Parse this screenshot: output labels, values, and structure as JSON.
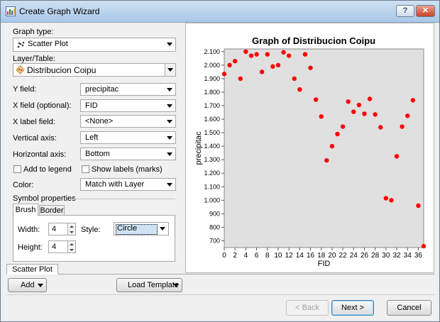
{
  "window": {
    "title": "Create Graph Wizard",
    "help_label": "?",
    "close_label": "✕"
  },
  "form": {
    "graph_type_label": "Graph type:",
    "graph_type_value": "Scatter Plot",
    "layer_label": "Layer/Table:",
    "layer_value": "Distribucion Coipu",
    "y_field_label": "Y field:",
    "y_field_value": "precipitac",
    "x_field_label": "X field (optional):",
    "x_field_value": "FID",
    "x_label_field_label": "X label field:",
    "x_label_field_value": "<None>",
    "vertical_axis_label": "Vertical axis:",
    "vertical_axis_value": "Left",
    "horizontal_axis_label": "Horizontal axis:",
    "horizontal_axis_value": "Bottom",
    "add_to_legend_label": "Add to legend",
    "add_to_legend_checked": false,
    "show_labels_label": "Show labels (marks)",
    "show_labels_checked": false,
    "color_label": "Color:",
    "color_value": "Match with Layer",
    "symbol_properties_label": "Symbol properties",
    "tabs": [
      {
        "label": "Brush"
      },
      {
        "label": "Border"
      }
    ],
    "width_label": "Width:",
    "width_value": "4",
    "style_label": "Style:",
    "style_value": "Circle",
    "height_label": "Height:",
    "height_value": "4"
  },
  "bottom": {
    "graph_tab_label": "Scatter Plot",
    "add_label": "Add",
    "load_template_label": "Load Template"
  },
  "footer": {
    "back_label": "< Back",
    "next_label": "Next >",
    "cancel_label": "Cancel"
  },
  "chart_data": {
    "type": "scatter",
    "title": "Graph of Distribucion Coipu",
    "xlabel": "FID",
    "ylabel": "precipitac",
    "xlim": [
      0,
      37
    ],
    "ylim": [
      650,
      2120
    ],
    "x_ticks": [
      0,
      2,
      4,
      6,
      8,
      10,
      12,
      14,
      16,
      18,
      20,
      22,
      24,
      26,
      28,
      30,
      32,
      34,
      36
    ],
    "y_ticks": [
      700,
      800,
      900,
      1000,
      1100,
      1200,
      1300,
      1400,
      1500,
      1600,
      1700,
      1800,
      1900,
      2000,
      2100
    ],
    "y_tick_labels": [
      "700",
      "800",
      "900",
      "1.000",
      "1.100",
      "1.200",
      "1.300",
      "1.400",
      "1.500",
      "1.600",
      "1.700",
      "1.800",
      "1.900",
      "2.000",
      "2.100"
    ],
    "grid": false,
    "marker_color": "#ff0000",
    "plot_background": "#e0e0e0",
    "series": [
      {
        "x": [
          0,
          1,
          2,
          3,
          4,
          5,
          6,
          7,
          8,
          9,
          10,
          11,
          12,
          13,
          14,
          15,
          16,
          17,
          18,
          19,
          20,
          21,
          22,
          23,
          24,
          25,
          26,
          27,
          28,
          29,
          30,
          31,
          32,
          33,
          34,
          35,
          36,
          37
        ],
        "values": [
          1935,
          2000,
          2030,
          1900,
          2100,
          2070,
          2080,
          1950,
          2080,
          1990,
          2000,
          2095,
          2070,
          1900,
          1820,
          2080,
          1980,
          1745,
          1620,
          1295,
          1400,
          1490,
          1545,
          1730,
          1655,
          1705,
          1640,
          1750,
          1635,
          1540,
          1015,
          1000,
          1325,
          1545,
          1625,
          1740,
          960,
          660
        ]
      }
    ]
  }
}
